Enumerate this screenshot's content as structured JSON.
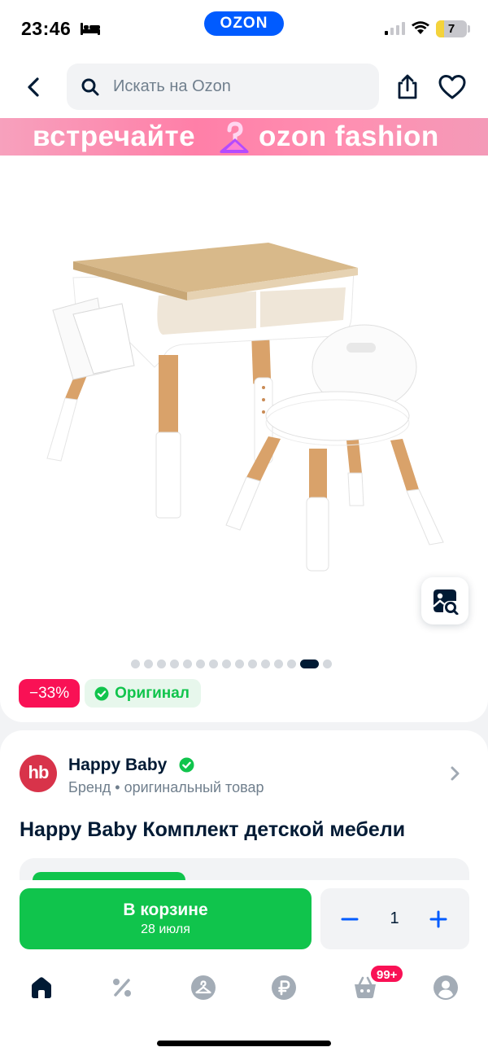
{
  "status_bar": {
    "time": "23:46",
    "carrier_logo": "OZON",
    "battery": "7"
  },
  "header": {
    "search_placeholder": "Искать на Ozon",
    "icons": [
      "back-icon",
      "search-icon",
      "share-icon",
      "heart-icon"
    ]
  },
  "banner": {
    "left_text": "встречайте",
    "right_text": "ozon fashion"
  },
  "gallery": {
    "image_count": 15,
    "active_index": 13,
    "badges": {
      "discount": "−33%",
      "original": "Оригинал"
    }
  },
  "brand": {
    "logo_text": "hb",
    "name": "Happy Baby",
    "subtitle": "Бренд • оригинальный товар"
  },
  "product": {
    "title": "Happy Baby Комплект детской мебели"
  },
  "buy_bar": {
    "cart_label": "В корзине",
    "delivery_date": "28 июля",
    "quantity": "1"
  },
  "tab_bar": {
    "cart_badge": "99+",
    "tabs": [
      "home",
      "promo",
      "fashion",
      "finance",
      "cart",
      "profile"
    ]
  },
  "colors": {
    "ozon_blue": "#005bff",
    "green": "#10c44c",
    "pink": "#f91155",
    "text": "#001a34",
    "secondary": "#707f8d"
  }
}
